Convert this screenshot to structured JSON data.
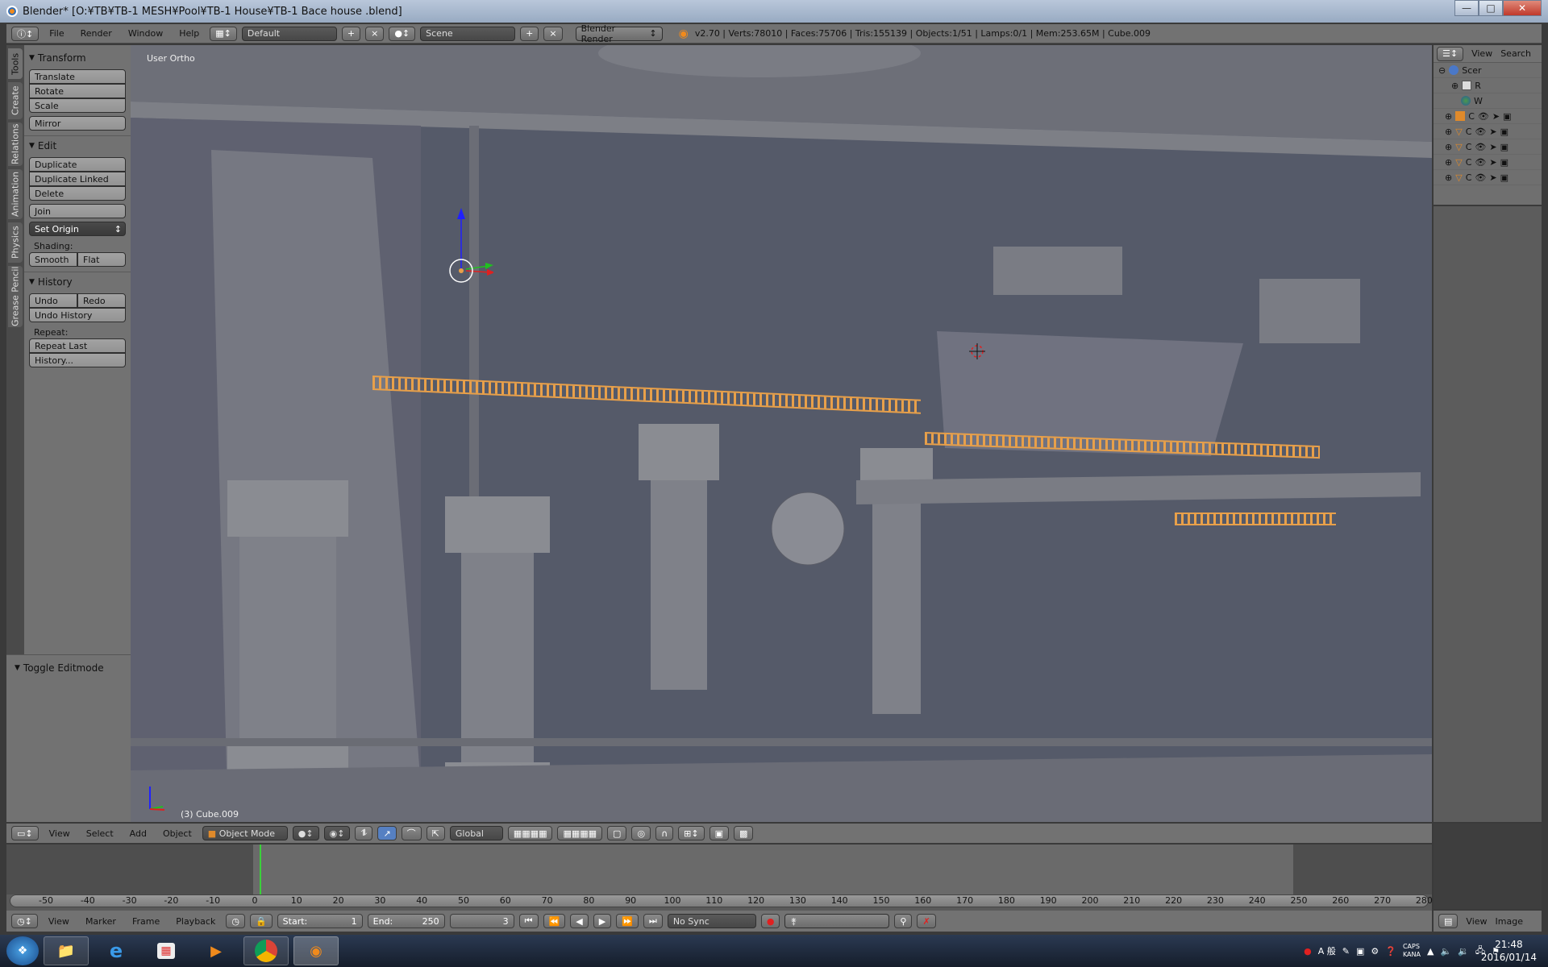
{
  "window": {
    "title": "Blender* [O:¥TB¥TB-1 MESH¥Pool¥TB-1 House¥TB-1 Bace house .blend]",
    "controls": [
      "minimize",
      "maximize",
      "close"
    ]
  },
  "info_header": {
    "editor_icon": "info-icon",
    "menus": [
      "File",
      "Render",
      "Window",
      "Help"
    ],
    "screen_layout": "Default",
    "scene": "Scene",
    "render_engine": "Blender Render",
    "stats": "v2.70 | Verts:78010 | Faces:75706 | Tris:155139 | Objects:1/51 | Lamps:0/1 | Mem:253.65M | Cube.009"
  },
  "tool_shelf": {
    "tabs": [
      "Tools",
      "Create",
      "Relations",
      "Animation",
      "Physics",
      "Grease Pencil"
    ],
    "active_tab": "Tools",
    "transform": {
      "title": "Transform",
      "buttons": [
        "Translate",
        "Rotate",
        "Scale",
        "Mirror"
      ]
    },
    "edit": {
      "title": "Edit",
      "buttons": [
        "Duplicate",
        "Duplicate Linked",
        "Delete",
        "Join"
      ],
      "set_origin": "Set Origin",
      "shading_label": "Shading:",
      "shading": [
        "Smooth",
        "Flat"
      ]
    },
    "history": {
      "title": "History",
      "undo": "Undo",
      "redo": "Redo",
      "undo_history": "Undo History",
      "repeat_label": "Repeat:",
      "repeat_last": "Repeat Last",
      "history": "History..."
    },
    "operator_panel": "Toggle Editmode"
  },
  "viewport": {
    "view_name": "User Ortho",
    "active_object": "(3) Cube.009",
    "colors": {
      "background": "#555a69",
      "selection": "#e8a04a"
    }
  },
  "outliner": {
    "header": [
      "View",
      "Search"
    ],
    "rows": [
      {
        "label": "Scer",
        "icon": "scene-icon"
      },
      {
        "label": "R",
        "icon": "render-layers-icon"
      },
      {
        "label": "W",
        "icon": "world-icon"
      },
      {
        "label": "C",
        "icon": "camera-icon"
      },
      {
        "label": "C",
        "icon": "mesh-icon"
      },
      {
        "label": "C",
        "icon": "mesh-icon"
      },
      {
        "label": "C",
        "icon": "mesh-icon"
      },
      {
        "label": "C",
        "icon": "mesh-icon"
      }
    ]
  },
  "view3d_header": {
    "menus": [
      "View",
      "Select",
      "Add",
      "Object"
    ],
    "mode": "Object Mode",
    "orientation": "Global"
  },
  "timeline": {
    "ticks": [
      -50,
      -40,
      -30,
      -20,
      -10,
      0,
      10,
      20,
      30,
      40,
      50,
      60,
      70,
      80,
      90,
      100,
      110,
      120,
      130,
      140,
      150,
      160,
      170,
      180,
      190,
      200,
      210,
      220,
      230,
      240,
      250,
      260,
      270,
      280
    ],
    "menus": [
      "View",
      "Marker",
      "Frame",
      "Playback"
    ],
    "start_label": "Start:",
    "start": "1",
    "end_label": "End:",
    "end": "250",
    "current_frame": "3",
    "sync": "No Sync"
  },
  "image_editor": {
    "menus": [
      "View",
      "Image"
    ]
  },
  "taskbar": {
    "apps": [
      "start",
      "explorer",
      "internet-explorer",
      "app-grid",
      "media-player",
      "chrome",
      "blender"
    ],
    "tray": {
      "ime": "A 般",
      "caps": "CAPS",
      "kana": "KANA"
    },
    "time": "21:48",
    "date": "2016/01/14"
  }
}
